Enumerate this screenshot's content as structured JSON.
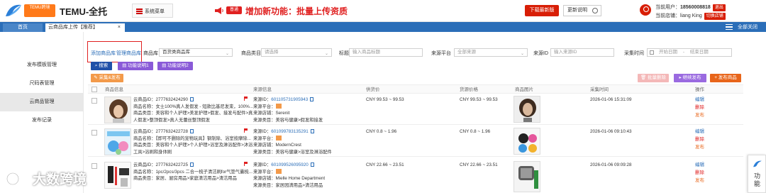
{
  "header": {
    "brand_badge": "TEMU跨境",
    "brand_name": "TEMU-全托",
    "system_menu_label": "系统菜单",
    "announcement_tag": "普通",
    "announcement_text": "增加新功能：批量上传资质",
    "download_button": "下载最新版",
    "update_notes_button": "更新说明",
    "current_user_label": "当前用户：",
    "current_user_value": "18560008818",
    "logout_button": "退出",
    "current_shop_label": "当前店铺：",
    "current_shop_value": "liang King",
    "switch_shop_button": "切换店铺"
  },
  "tabs": {
    "home": "首页",
    "active": "云商品库上传【推荐】",
    "active_close": "×",
    "close_all": "全部关闭"
  },
  "sidebar": {
    "items": [
      {
        "label": "发布模板管理"
      },
      {
        "label": "尺码表管理"
      },
      {
        "label": "云商品管理"
      },
      {
        "label": "发布记录"
      }
    ]
  },
  "filters": {
    "add_library_link": "添加商品库",
    "manage_library_link": "管理商品库",
    "library_label": "商品库",
    "library_value": "百货类商品库",
    "category_label": "商品类目",
    "category_placeholder": "请选择",
    "title_label": "标题",
    "title_placeholder": "输入商品标题",
    "platform_label": "来源平台",
    "platform_value": "全部来源",
    "source_id_label": "来源ID",
    "source_id_placeholder": "输入来源ID",
    "collect_time_label": "采集时间",
    "start_placeholder": "开始日期",
    "range_separator": "-",
    "end_placeholder": "结束日期"
  },
  "buttons": {
    "search": "搜索",
    "help1": "功能说明1",
    "help2": "功能说明2",
    "collect": "采集&发布",
    "batch_delete": "批量删除",
    "continue_publish": "继续发布",
    "publish_product": "发布商品"
  },
  "table": {
    "headers": [
      "商品信息",
      "来源信息",
      "供货价",
      "货源价格",
      "商品图片",
      "采集时间",
      "操作"
    ],
    "rows": [
      {
        "cloud_id": "云商品ID：2777632424290",
        "name": "商品名称：女士100%真人发假发 - 短款比基尼发束，100%...",
        "category1": "商品类目：美容和个人护理>美发护理>假发、接发与配件>真",
        "category2": "人假发>整顶假发>真人无蕾丝整顶假发",
        "source_id_label": "来源ID：",
        "source_id": "601105731905943",
        "platform_label": "来源平台：",
        "shop_label": "来源店铺：",
        "shop": "Serenit",
        "source_cat_label": "来源类目：",
        "source_cat": "美容与健康>假发和接发",
        "supply_price": "CNY 99.53 ~ 99.53",
        "source_price": "CNY 99.53 ~ 99.53",
        "collect_time": "2026-01-06 15:31:09",
        "op_edit": "编辑",
        "op_delete": "删除",
        "op_publish": "发布"
      },
      {
        "cloud_id": "云商品ID：2777632422728",
        "name": "商品名称：【即可不删除的宠物玩具】钢制除、浴室按摩除...",
        "category1": "商品类目：美容和个人护理>个人护理>浴室及淋浴配件>沐浴",
        "category2": "工具>浴刷和身体刷",
        "source_id_label": "来源ID：",
        "source_id": "601099783135291",
        "platform_label": "来源平台：",
        "shop_label": "来源店铺：",
        "shop": "ModernCrest",
        "source_cat_label": "来源类目：",
        "source_cat": "美容与健康>浴室及淋浴配件",
        "supply_price": "CNY 0.8 ~ 1.96",
        "source_price": "CNY 0.8 ~ 1.96",
        "collect_time": "2026-01-06 09:10:43",
        "op_edit": "编辑",
        "op_delete": "删除",
        "op_publish": "发布"
      },
      {
        "cloud_id": "云商品ID：2777632422725",
        "name": "商品名称：1pc/2pcs/3pcs 二合一梳子清洁刷for气垫气囊梳...",
        "category1": "商品类目：家居、厨房用品>家庭清洁用品>清洁用品",
        "category2": "",
        "source_id_label": "来源ID：",
        "source_id": "601099526095920",
        "platform_label": "来源平台：",
        "shop_label": "来源店铺：",
        "shop": "Mielle Home Department",
        "source_cat_label": "来源类目：",
        "source_cat": "家居园清用品>清洁用品",
        "supply_price": "CNY 22.66 ~ 23.51",
        "source_price": "CNY 22.66 ~ 23.51",
        "collect_time": "2026-01-06 09:09:28",
        "op_edit": "编辑",
        "op_delete": "删除",
        "op_publish": "发布"
      }
    ]
  },
  "watermark": {
    "text": "大数跨境"
  },
  "float_panel": {
    "label": "功能"
  },
  "colors": {
    "brand_red": "#d81e06",
    "tab_blue": "#2b6eb8",
    "purple": "#8a5ad8",
    "orange": "#e8651a"
  }
}
